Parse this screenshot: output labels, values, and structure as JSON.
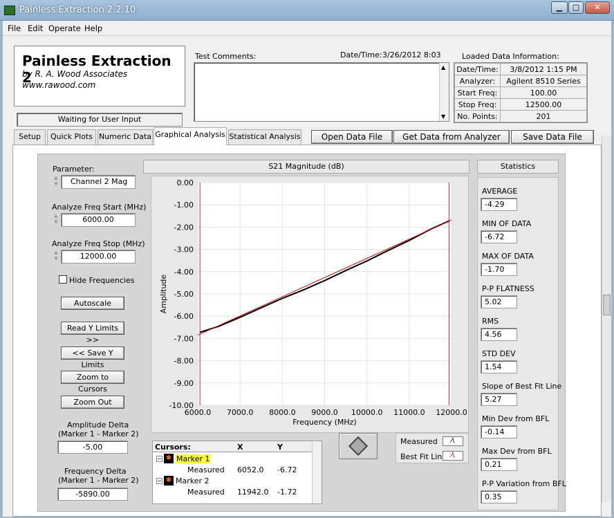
{
  "window": {
    "title": "Painless Extraction 2.2.10"
  },
  "menu": [
    "File",
    "Edit",
    "Operate",
    "Help"
  ],
  "header": {
    "app_name": "Painless Extraction 2",
    "byline": "by R. A. Wood Associates",
    "website": "www.rawood.com"
  },
  "status": "Waiting for User Input",
  "comments": {
    "label": "Test Comments:",
    "datetime_label": "Date/Time:",
    "datetime_value": "3/26/2012  8:03"
  },
  "loaded": {
    "title": "Loaded Data Information:",
    "rows": [
      [
        "Date/Time:",
        "3/8/2012 1:15 PM"
      ],
      [
        "Analyzer:",
        "Agilent 8510 Series"
      ],
      [
        "Start Freq:",
        "100.00"
      ],
      [
        "Stop Freq:",
        "12500.00"
      ],
      [
        "No. Points:",
        "201"
      ]
    ]
  },
  "tabs": [
    "Setup",
    "Quick Plots",
    "Numeric Data",
    "Graphical Analysis",
    "Statistical Analysis"
  ],
  "active_tab": "Graphical Analysis",
  "actions": {
    "open": "Open Data File",
    "get": "Get Data from Analyzer",
    "save": "Save Data File"
  },
  "controls": {
    "param_label": "Parameter:",
    "param_value": "Channel 2 Mag",
    "start_label": "Analyze Freq Start (MHz)",
    "start_value": "6000.00",
    "stop_label": "Analyze Freq Stop (MHz)",
    "stop_value": "12000.00",
    "hide_freq": "Hide Frequencies",
    "autoscale": "Autoscale",
    "read_y": "Read Y Limits >>",
    "save_y": "<< Save Y Limits",
    "zoom_cursors": "Zoom to Cursors",
    "zoom_out": "Zoom Out",
    "amp_delta_label1": "Amplitude Delta",
    "amp_delta_label2": "(Marker 1 - Marker 2)",
    "amp_delta_value": "-5.00",
    "freq_delta_label1": "Frequency Delta",
    "freq_delta_label2": "(Marker 1 - Marker 2)",
    "freq_delta_value": "-5890.00"
  },
  "cursors": {
    "title": "Cursors:",
    "col_x": "X",
    "col_y": "Y",
    "m1": "Marker 1",
    "m2": "Marker 2",
    "m1_sub": "Measured",
    "m2_sub": "Measured",
    "m1_x": "6052.0",
    "m1_y": "-6.72",
    "m2_x": "11942.0",
    "m2_y": "-1.72"
  },
  "legend": {
    "measured": "Measured",
    "bfl": "Best Fit Line"
  },
  "stats": {
    "title": "Statistics",
    "items": [
      [
        "AVERAGE",
        "-4.29"
      ],
      [
        "MIN OF DATA",
        "-6.72"
      ],
      [
        "MAX OF DATA",
        "-1.70"
      ],
      [
        "P-P FLATNESS",
        "5.02"
      ],
      [
        "RMS",
        "4.56"
      ],
      [
        "STD DEV",
        "1.54"
      ],
      [
        "Slope of Best Fit Line",
        "5.27"
      ],
      [
        "Min Dev from BFL",
        "-0.14"
      ],
      [
        "Max Dev from BFL",
        "0.21"
      ],
      [
        "P-P Variation from BFL",
        "0.35"
      ]
    ]
  },
  "chart_data": {
    "type": "line",
    "title": "S21 Magnitude (dB)",
    "xlabel": "Frequency (MHz)",
    "ylabel": "Amplitude",
    "xlim": [
      6000,
      12000
    ],
    "ylim": [
      -10,
      0
    ],
    "x_ticks": [
      "6000.0",
      "7000.0",
      "8000.0",
      "9000.0",
      "10000.0",
      "11000.0",
      "12000.0"
    ],
    "y_ticks": [
      "0.00",
      "-1.00",
      "-2.00",
      "-3.00",
      "-4.00",
      "-5.00",
      "-6.00",
      "-7.00",
      "-8.00",
      "-9.00",
      "-10.00"
    ],
    "series": [
      {
        "name": "Measured",
        "color": "#000000",
        "x": [
          6052,
          6500,
          7000,
          7500,
          8000,
          8500,
          9000,
          9500,
          10000,
          10500,
          11000,
          11500,
          11942
        ],
        "y": [
          -6.72,
          -6.45,
          -6.05,
          -5.62,
          -5.2,
          -4.82,
          -4.4,
          -3.95,
          -3.52,
          -3.05,
          -2.6,
          -2.1,
          -1.72
        ]
      },
      {
        "name": "Best Fit Line",
        "color": "#cc0000",
        "x": [
          6000,
          12000
        ],
        "y": [
          -6.85,
          -1.68
        ]
      }
    ],
    "markers": [
      {
        "x": 6052
      },
      {
        "x": 11942
      }
    ]
  }
}
